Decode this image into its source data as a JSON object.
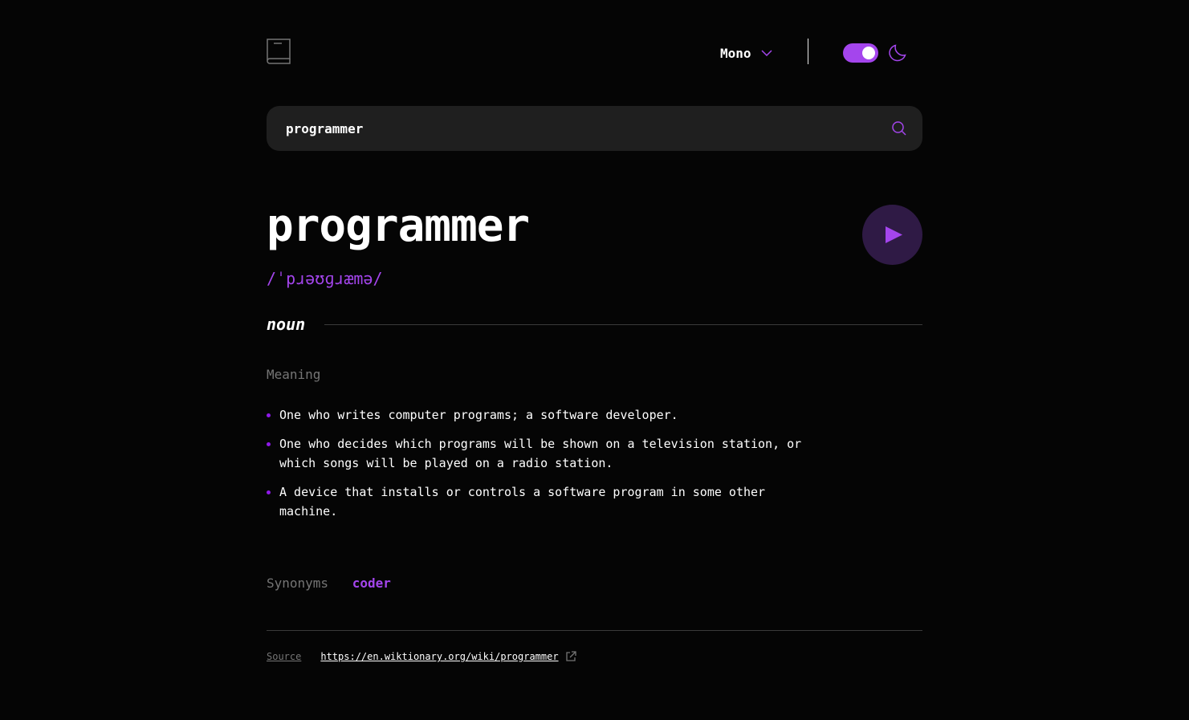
{
  "header": {
    "font_label": "Mono",
    "theme": "dark"
  },
  "search": {
    "value": "programmer",
    "placeholder": ""
  },
  "entry": {
    "word": "programmer",
    "phonetic": "/ˈpɹəʊɡɹæmə/",
    "part_of_speech": "noun",
    "meaning_heading": "Meaning",
    "definitions": [
      "One who writes computer programs; a software developer.",
      "One who decides which programs will be shown on a television station, or which songs will be played on a radio station.",
      "A device that installs or controls a software program in some other machine."
    ],
    "synonyms_label": "Synonyms",
    "synonyms": [
      "coder"
    ]
  },
  "source": {
    "label": "Source",
    "url": "https://en.wiktionary.org/wiki/programmer"
  },
  "colors": {
    "accent": "#a445ed",
    "background": "#050505",
    "search_bg": "#1f1f1f",
    "muted": "#757575"
  },
  "icons": [
    "book-logo-icon",
    "chevron-down-icon",
    "moon-icon",
    "search-icon",
    "play-icon",
    "external-link-icon"
  ]
}
